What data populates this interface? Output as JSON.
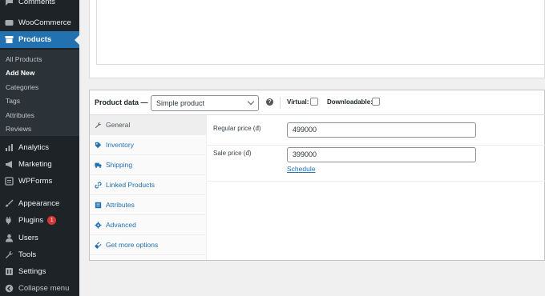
{
  "sidebar": {
    "comments_label": "Comments",
    "woocommerce_label": "WooCommerce",
    "products_label": "Products",
    "submenu": [
      "All Products",
      "Add New",
      "Categories",
      "Tags",
      "Attributes",
      "Reviews"
    ],
    "analytics_label": "Analytics",
    "marketing_label": "Marketing",
    "wpforms_label": "WPForms",
    "appearance_label": "Appearance",
    "plugins_label": "Plugins",
    "plugins_badge": "1",
    "users_label": "Users",
    "tools_label": "Tools",
    "settings_label": "Settings",
    "collapse_label": "Collapse menu"
  },
  "product_data": {
    "title": "Product data —",
    "type_value": "Simple product",
    "help": "?",
    "virtual_label": "Virtual:",
    "downloadable_label": "Downloadable:",
    "tabs": [
      "General",
      "Inventory",
      "Shipping",
      "Linked Products",
      "Attributes",
      "Advanced",
      "Get more options"
    ],
    "regular_price_label": "Regular price (đ)",
    "regular_price_value": "499000",
    "sale_price_label": "Sale price (đ)",
    "sale_price_value": "399000",
    "schedule_link": "Schedule"
  },
  "colors": {
    "sidebar_bg": "#1d2327",
    "accent": "#2271b1",
    "badge": "#d63638"
  }
}
